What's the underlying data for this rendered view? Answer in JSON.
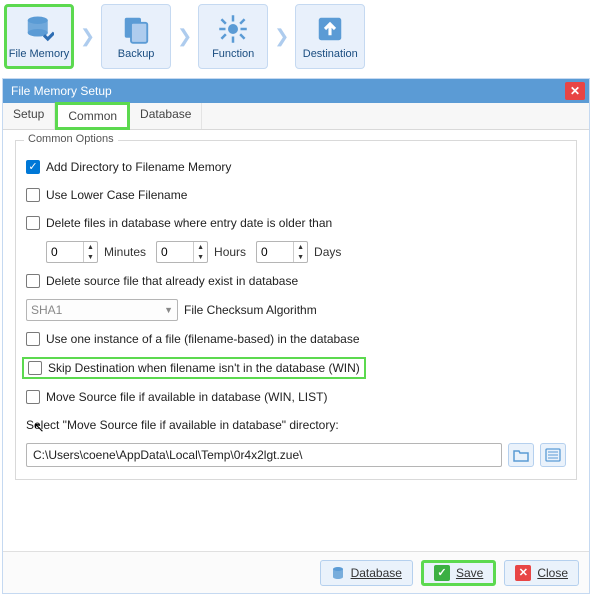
{
  "toolbar": {
    "steps": [
      {
        "label": "File Memory"
      },
      {
        "label": "Backup"
      },
      {
        "label": "Function"
      },
      {
        "label": "Destination"
      }
    ]
  },
  "dialog": {
    "title": "File Memory Setup",
    "tabs": [
      {
        "label": "Setup"
      },
      {
        "label": "Common"
      },
      {
        "label": "Database"
      }
    ]
  },
  "fieldset": {
    "legend": "Common Options",
    "addDirectory": "Add Directory to Filename Memory",
    "lowerCase": "Use Lower Case Filename",
    "deleteOlder": "Delete files in database where entry date is older than",
    "minutes": {
      "value": "0",
      "label": "Minutes"
    },
    "hours": {
      "value": "0",
      "label": "Hours"
    },
    "days": {
      "value": "0",
      "label": "Days"
    },
    "deleteSource": "Delete source file that already exist in database",
    "checksum": {
      "value": "SHA1",
      "label": "File Checksum Algorithm"
    },
    "oneInstance": "Use one instance of a file (filename-based) in the database",
    "skipDest": "Skip Destination when filename isn't  in the database (WIN)",
    "moveSource": "Move Source file if available in database (WIN, LIST)",
    "selectDir": "Select \"Move Source file if available in database\" directory:",
    "path": "C:\\Users\\coene\\AppData\\Local\\Temp\\0r4x2lgt.zue\\"
  },
  "footer": {
    "database": "Database",
    "save": "Save",
    "close": "Close"
  }
}
